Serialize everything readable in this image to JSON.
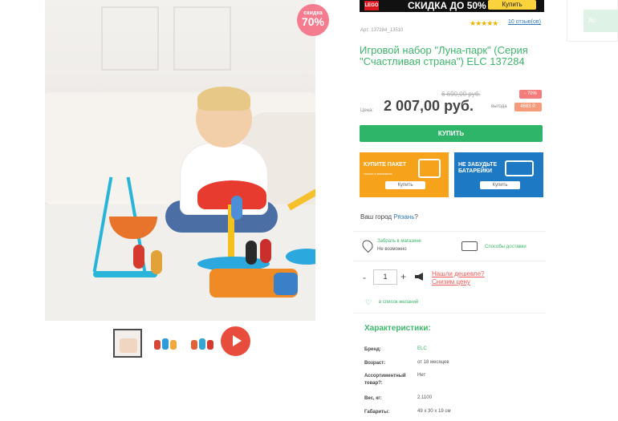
{
  "gallery": {
    "badge_title": "скидка",
    "badge_value": "70%"
  },
  "banner": {
    "brand": "LEGO",
    "text": "СКИДКА ДО 50%",
    "button": "Купить"
  },
  "product": {
    "stars": "★★★★★",
    "reviews": "10 отзыв(ов)",
    "sku": "Арт: 137284_13510",
    "title": "Игровой набор \"Луна-парк\" (Серия \"Счастливая страна\") ELC 137284",
    "old_price": "6 690,00 руб.",
    "discount": "- 70%",
    "price_label": "Цена:",
    "price": "2 007,00 руб.",
    "save_label": "выгода",
    "save_value": "4683 Р.",
    "buy_label": "КУПИТЬ"
  },
  "promos": [
    {
      "title": "КУПИТЕ ПАКЕТ",
      "subtitle": "только в магазинах",
      "button": "Купить",
      "color": "#f7a21b",
      "icon": "bag-icon"
    },
    {
      "title": "НЕ ЗАБУДЬТЕ БАТАРЕЙКИ",
      "subtitle": "",
      "button": "Купить",
      "color": "#1e79c5",
      "icon": "battery-icon"
    }
  ],
  "city": {
    "prefix": "Ваш город",
    "name": "Рязань",
    "suffix": "?"
  },
  "delivery": {
    "pickup_label": "Забрать в магазине",
    "pickup_status": "Не возможно",
    "delivery_label": "Способы доставки"
  },
  "quantity": {
    "minus": "-",
    "value": "1",
    "plus": "+",
    "cheaper_line1": "Нашли дешевле?",
    "cheaper_line2": "Снизим цену"
  },
  "wishlist": "в список желаний",
  "specs": {
    "title": "Характеристики:",
    "rows": [
      {
        "label": "Бренд:",
        "value": "ELC"
      },
      {
        "label": "Возраст:",
        "value": "от 18 месяцев"
      },
      {
        "label": "Ассортиментный товар?:",
        "value": "Нет"
      },
      {
        "label": "Вес, кг:",
        "value": "2.1100"
      },
      {
        "label": "Габариты:",
        "value": "49 x 30 x 19 см"
      }
    ]
  },
  "side": {
    "button": "Ас"
  },
  "colors": {
    "green": "#3cb76b",
    "buy": "#2eb56a",
    "badge": "#f47c8e",
    "play": "#e74c3c"
  }
}
